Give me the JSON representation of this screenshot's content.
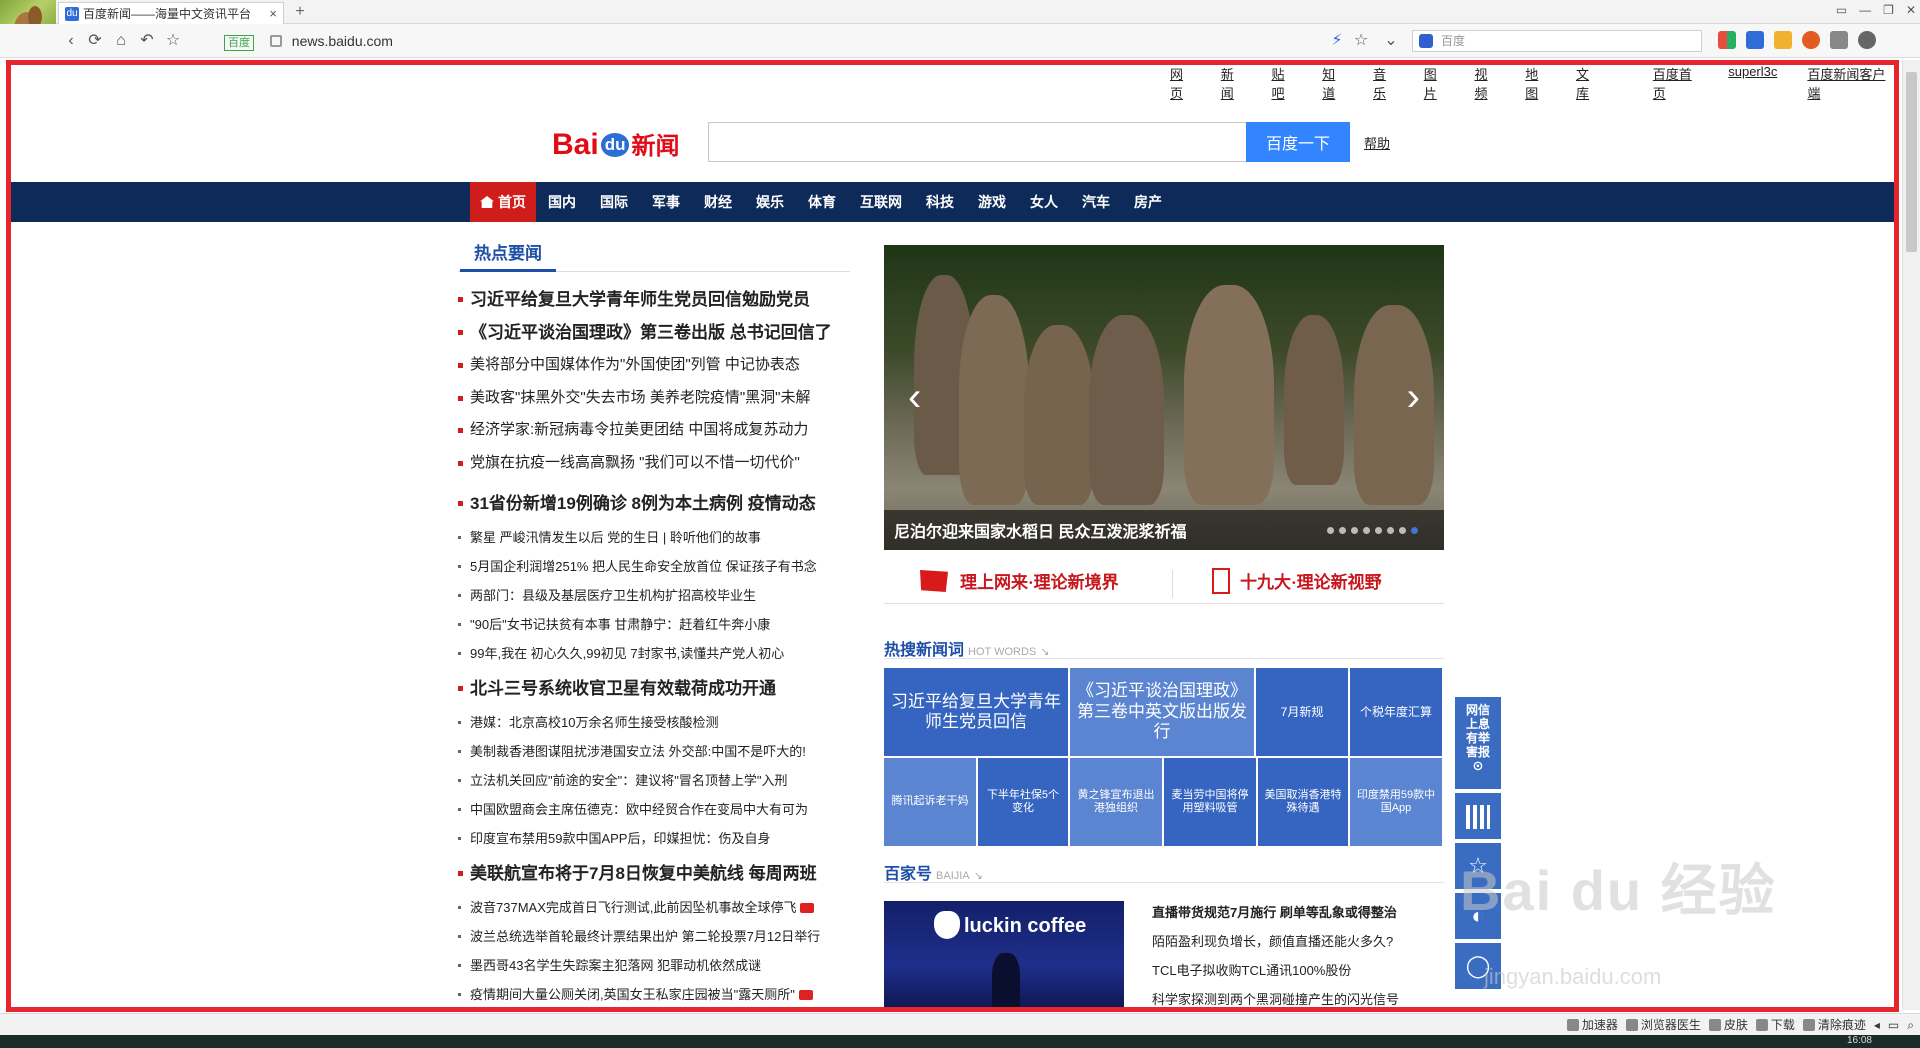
{
  "browser": {
    "tab_title": "百度新闻——海量中文资讯平台",
    "tab_favicon": "du",
    "close": "×",
    "new_tab": "+",
    "url_badge": "百度",
    "url": "news.baidu.com",
    "search_placeholder": "百度",
    "window_controls": [
      "▭",
      "—",
      "❐",
      "✕"
    ]
  },
  "topnav": {
    "links": [
      "网页",
      "新闻",
      "贴吧",
      "知道",
      "音乐",
      "图片",
      "视频",
      "地图",
      "文库"
    ],
    "right_links": [
      "百度首页",
      "superl3c",
      "百度新闻客户端"
    ]
  },
  "logo": {
    "bai": "Bai",
    "du": "du",
    "xinwen": "新闻"
  },
  "search": {
    "value": "",
    "button": "百度一下",
    "help": "帮助"
  },
  "channels": [
    "首页",
    "国内",
    "国际",
    "军事",
    "财经",
    "娱乐",
    "体育",
    "互联网",
    "科技",
    "游戏",
    "女人",
    "汽车",
    "房产"
  ],
  "hot": {
    "tab_label": "热点要闻",
    "group1": [
      "习近平给复旦大学青年师生党员回信勉励党员",
      "《习近平谈治国理政》第三卷出版 总书记回信了"
    ],
    "group1b": [
      "美将部分中国媒体作为\"外国使团\"列管 中记协表态",
      "美政客\"抹黑外交\"失去市场 美养老院疫情\"黑洞\"未解",
      "经济学家:新冠病毒令拉美更团结 中国将成复苏动力",
      "党旗在抗疫一线高高飘扬 \"我们可以不惜一切代价\""
    ],
    "h2": "31省份新增19例确诊 8例为本土病例 疫情动态",
    "small1": [
      "繁星 严峻汛情发生以后 党的生日 | 聆听他们的故事",
      "5月国企利润增251% 把人民生命安全放首位 保证孩子有书念",
      "两部门：县级及基层医疗卫生机构扩招高校毕业生",
      "\"90后\"女书记扶贫有本事 甘肃静宁：赶着红牛奔小康",
      "99年,我在 初心久久,99初见 7封家书,读懂共产党人初心"
    ],
    "h3": "北斗三号系统收官卫星有效载荷成功开通",
    "small2": [
      "港媒：北京高校10万余名师生接受核酸检测",
      "美制裁香港图谋阻扰涉港国安立法 外交部:中国不是吓大的!",
      "立法机关回应\"前途的安全\"：建议将\"冒名顶替上学\"入刑",
      "中国欧盟商会主席伍德克：欧中经贸合作在变局中大有可为",
      "印度宣布禁用59款中国APP后，印媒担忧：伤及自身"
    ],
    "h4": "美联航宣布将于7月8日恢复中美航线 每周两班",
    "small3": [
      "波音737MAX完成首日飞行测试,此前因坠机事故全球停飞",
      "波兰总统选举首轮最终计票结果出炉 第二轮投票7月12日举行",
      "墨西哥43名学生失踪案主犯落网 犯罪动机依然成谜",
      "疫情期间大量公厕关闭,英国女王私家庄园被当\"露天厕所\""
    ]
  },
  "slider": {
    "caption": "尼泊尔迎来国家水稻日 民众互泼泥浆祈福",
    "prev": "‹",
    "next": "›",
    "dot_count": 8,
    "active_dot": 7
  },
  "theory": {
    "left": "理上网来·理论新境界",
    "right": "十九大·理论新视野"
  },
  "hotwords": {
    "title": "热搜新闻词",
    "en": "HOT WORDS",
    "big": [
      "习近平给复旦大学青年师生党员回信",
      "《习近平谈治国理政》第三卷中英文版出版发行",
      "7月新规",
      "个税年度汇算"
    ],
    "small": [
      "腾讯起诉老干妈",
      "下半年社保5个变化",
      "黄之锋宣布退出港独组织",
      "麦当劳中国将停用塑料吸管",
      "美国取消香港特殊待遇",
      "印度禁用59款中国App"
    ]
  },
  "baijia": {
    "title": "百家号",
    "en": "BAIJIA",
    "image_text": "luckin coffee",
    "items": [
      "直播带货规范7月施行 刷单等乱象或得整治",
      "陌陌盈利现负增长，颜值直播还能火多久?",
      "TCL电子拟收购TCL通讯100%股份",
      "科学家探测到两个黑洞碰撞产生的闪光信号"
    ]
  },
  "side": {
    "report": "网信上息有举害报",
    "arrow": "⊙"
  },
  "watermark": {
    "main": "Bai du 经验",
    "sub": "jingyan.baidu.com"
  },
  "status": [
    "加速器",
    "浏览器医生",
    "皮肤",
    "下载",
    "清除痕迹"
  ],
  "taskbar": {
    "clock": "16:08"
  }
}
